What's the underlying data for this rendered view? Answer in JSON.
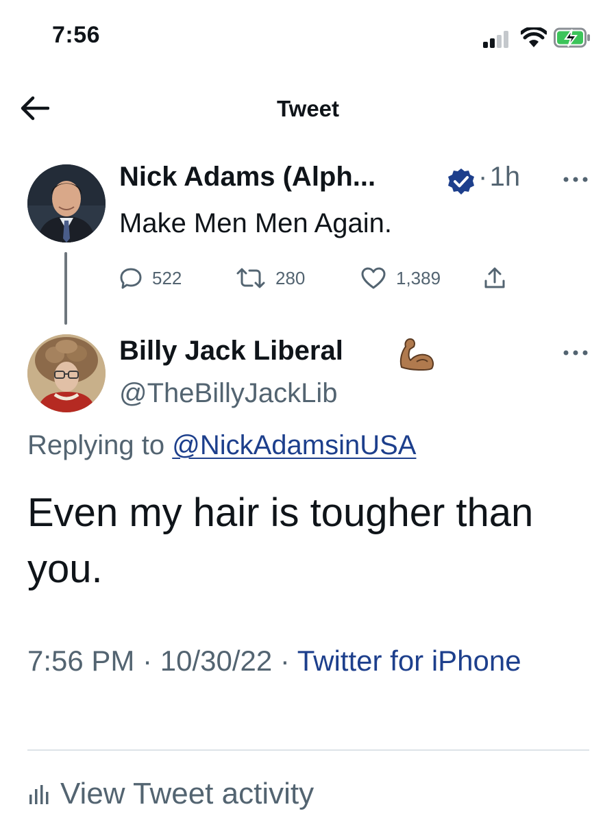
{
  "status_bar": {
    "time": "7:56"
  },
  "header": {
    "title": "Tweet"
  },
  "parent_tweet": {
    "name": "Nick Adams (Alph...",
    "time_ago": "1h",
    "text": "Make Men Men Again.",
    "replies": "522",
    "retweets": "280",
    "likes": "1,389"
  },
  "reply_tweet": {
    "name": "Billy Jack Liberal",
    "handle": "@TheBillyJackLib",
    "replying_prefix": "Replying to ",
    "replying_to": "@NickAdamsinUSA",
    "text": "Even my hair is tougher than you.",
    "timestamp": "7:56 PM · 10/30/22 · ",
    "source": "Twitter for iPhone"
  },
  "footer": {
    "activity_label": "View Tweet activity"
  },
  "colors": {
    "text": "#0f1419",
    "secondary": "#536471",
    "link": "#1d3f8c",
    "verified": "#1d3f8c"
  }
}
